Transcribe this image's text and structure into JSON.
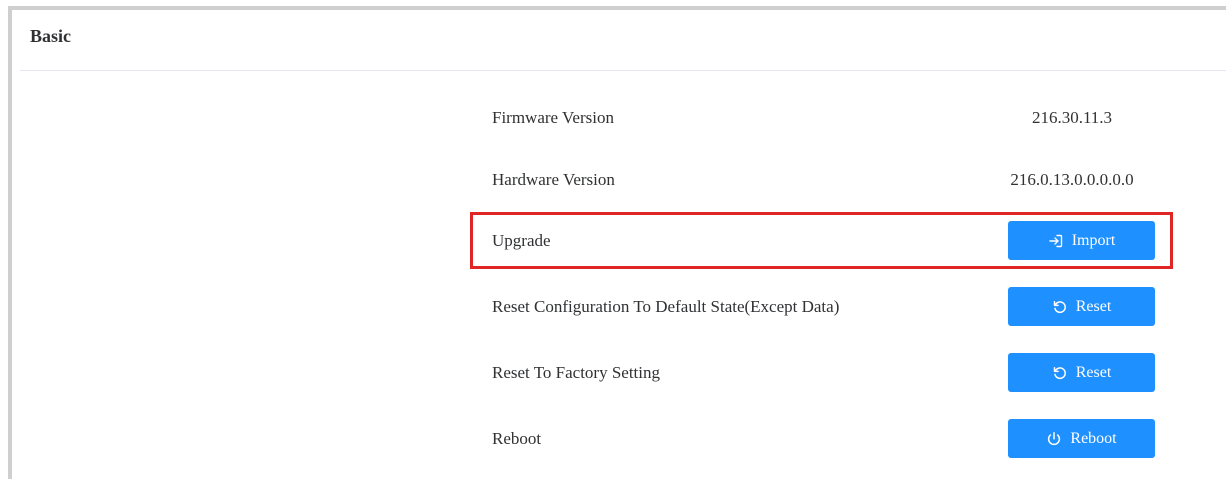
{
  "panel": {
    "title": "Basic"
  },
  "rows": [
    {
      "label": "Firmware Version",
      "value": "216.30.11.3"
    },
    {
      "label": "Hardware Version",
      "value": "216.0.13.0.0.0.0.0"
    },
    {
      "label": "Upgrade",
      "button_label": "Import",
      "button_icon": "import-icon"
    },
    {
      "label": "Reset Configuration To Default State(Except Data)",
      "button_label": "Reset",
      "button_icon": "reset-icon"
    },
    {
      "label": "Reset To Factory Setting",
      "button_label": "Reset",
      "button_icon": "reset-icon"
    },
    {
      "label": "Reboot",
      "button_label": "Reboot",
      "button_icon": "power-icon"
    }
  ],
  "colors": {
    "button": "#1e90ff",
    "highlight": "#e02525",
    "text": "#303133"
  }
}
